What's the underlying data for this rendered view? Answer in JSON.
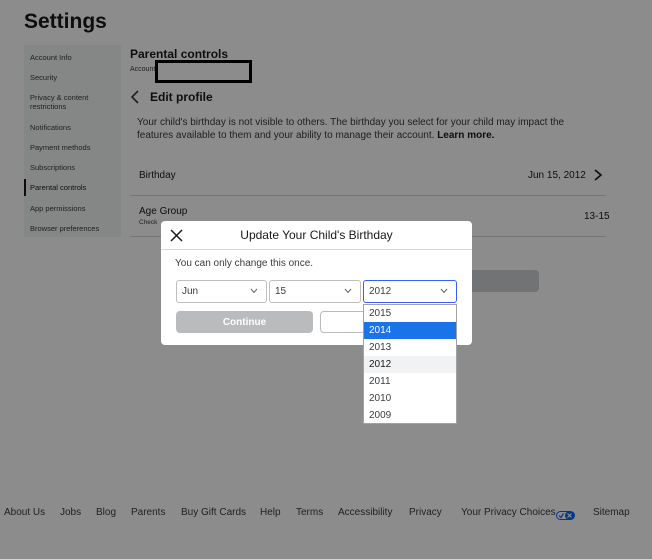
{
  "page": {
    "title": "Settings"
  },
  "sidebar": {
    "items": [
      {
        "label": "Account Info"
      },
      {
        "label": "Security"
      },
      {
        "label": "Privacy & content restrictions"
      },
      {
        "label": "Notifications"
      },
      {
        "label": "Payment methods"
      },
      {
        "label": "Subscriptions"
      },
      {
        "label": "Parental controls"
      },
      {
        "label": "App permissions"
      },
      {
        "label": "Browser preferences"
      }
    ],
    "active_index": 6
  },
  "main": {
    "section_title": "Parental controls",
    "account_label": "Account",
    "edit_profile_title": "Edit profile",
    "description": "Your child's birthday is not visible to others. The birthday you select for your child may impact the features available to them and your ability to manage their account.",
    "learn_more": "Learn more.",
    "birthday": {
      "label": "Birthday",
      "value": "Jun 15, 2012"
    },
    "age_group": {
      "label": "Age Group",
      "sub": "Check",
      "value": "13-15"
    }
  },
  "modal": {
    "title": "Update Your Child's Birthday",
    "note": "You can only change this once.",
    "month": "Jun",
    "day": "15",
    "year": "2012",
    "continue_label": "Continue",
    "year_options": [
      "2015",
      "2014",
      "2013",
      "2012",
      "2011",
      "2010",
      "2009"
    ],
    "highlighted_option": "2014",
    "current_option": "2012"
  },
  "footer": {
    "links": [
      "About Us",
      "Jobs",
      "Blog",
      "Parents",
      "Buy Gift Cards",
      "Help",
      "Terms",
      "Accessibility",
      "Privacy",
      "Your Privacy Choices",
      "Sitemap"
    ]
  },
  "colors": {
    "accent": "#335fff",
    "dropdown_highlight": "#1a73e8",
    "overlay": "rgba(0,0,0,0.45)"
  }
}
